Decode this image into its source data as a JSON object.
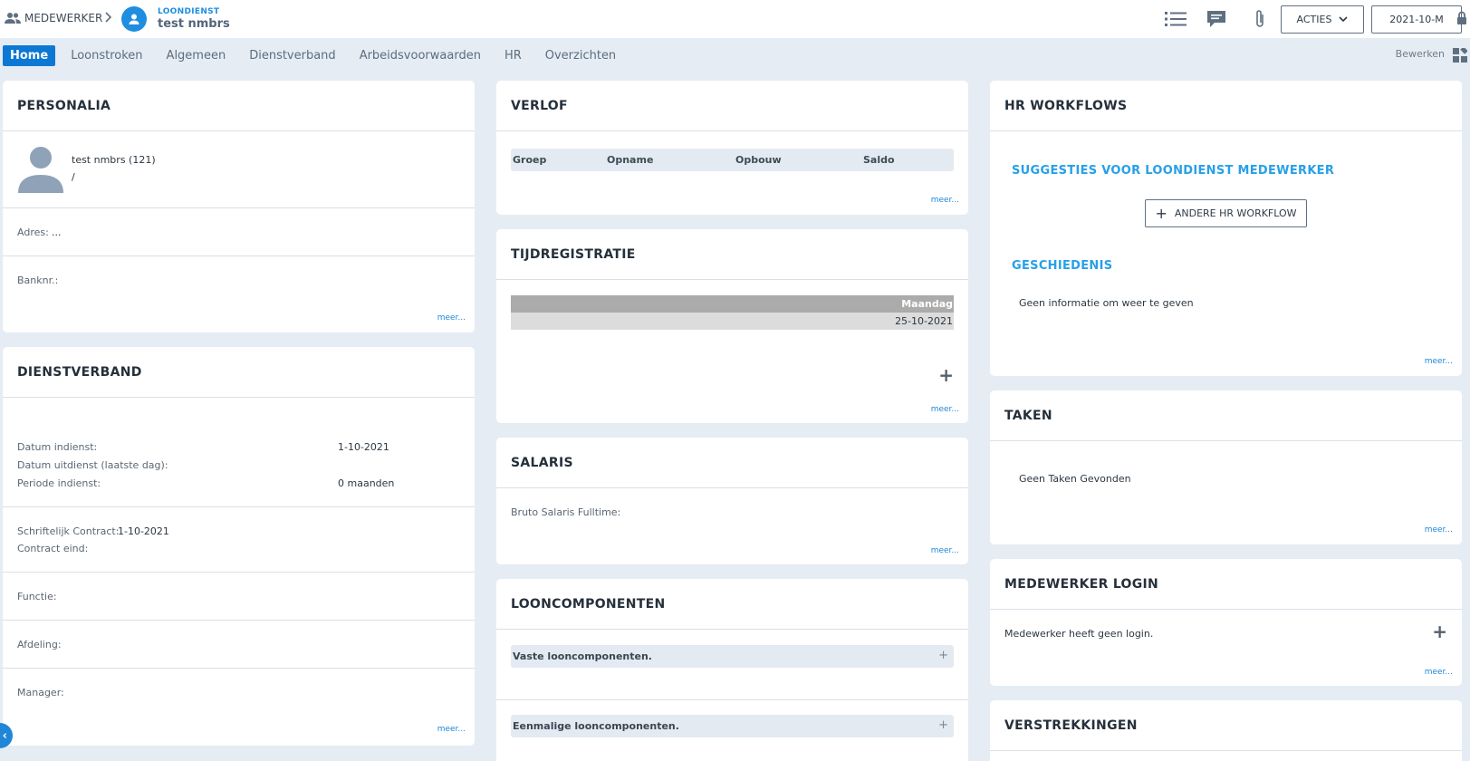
{
  "header": {
    "employees_label": "MEDEWERKER",
    "department_label": "LOONDIENST",
    "employee_name": "test nmbrs",
    "acties_label": "ACTIES",
    "period_label": "2021-10-M"
  },
  "tabs": [
    "Home",
    "Loonstroken",
    "Algemeen",
    "Dienstverband",
    "Arbeidsvoorwaarden",
    "HR",
    "Overzichten"
  ],
  "edit_label": "Bewerken",
  "more_label": "meer...",
  "personalia": {
    "title": "PERSONALIA",
    "name": "test nmbrs (121)",
    "subline": "/",
    "address_label": "Adres:",
    "address_value": "...",
    "bank_label": "Banknr.:"
  },
  "dienstverband": {
    "title": "DIENSTVERBAND",
    "rows": [
      {
        "label": "Datum indienst:",
        "value": "1-10-2021"
      },
      {
        "label": "Datum uitdienst (laatste dag):",
        "value": ""
      },
      {
        "label": "Periode indienst:",
        "value": "0 maanden"
      }
    ],
    "contract_label": "Schriftelijk Contract:",
    "contract_value": "1-10-2021",
    "contract_end_label": "Contract eind:",
    "function_label": "Functie:",
    "department_label": "Afdeling:",
    "manager_label": "Manager:"
  },
  "verlof": {
    "title": "VERLOF",
    "columns": [
      "Groep",
      "Opname",
      "Opbouw",
      "Saldo"
    ]
  },
  "tijdregistratie": {
    "title": "TIJDREGISTRATIE",
    "day_header": "Maandag",
    "date": "25-10-2021"
  },
  "salaris": {
    "title": "SALARIS",
    "gross_label": "Bruto Salaris Fulltime:"
  },
  "looncomponenten": {
    "title": "LOONCOMPONENTEN",
    "fixed": "Vaste looncomponenten.",
    "once": "Eenmalige looncomponenten."
  },
  "hr_workflows": {
    "title": "HR WORKFLOWS",
    "suggestions_title": "SUGGESTIES VOOR LOONDIENST MEDEWERKER",
    "other_button": "ANDERE HR WORKFLOW",
    "history_title": "GESCHIEDENIS",
    "history_empty": "Geen informatie om weer te geven"
  },
  "taken": {
    "title": "TAKEN",
    "empty": "Geen Taken Gevonden"
  },
  "login": {
    "title": "MEDEWERKER LOGIN",
    "text": "Medewerker heeft geen login."
  },
  "verstrekkingen": {
    "title": "VERSTREKKINGEN"
  },
  "colors": {
    "accent": "#1f8ee0",
    "active_tab": "#0d78d4",
    "background": "#e5ecf4",
    "section_title": "#27a0e8"
  }
}
